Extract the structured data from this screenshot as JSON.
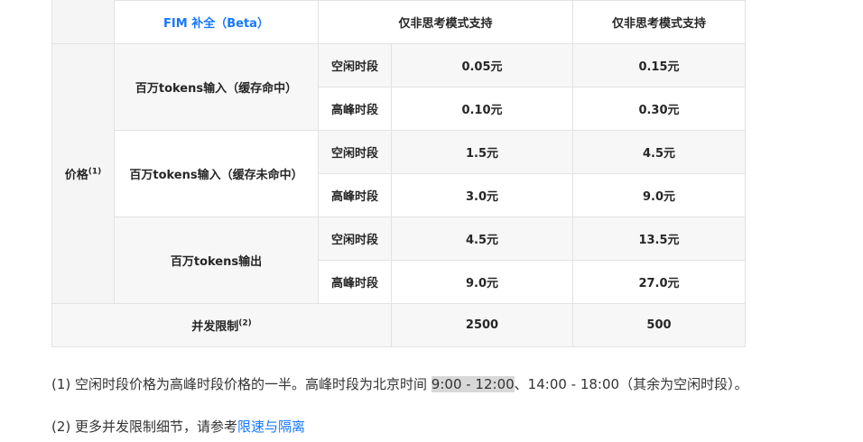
{
  "table": {
    "fim_label": "FIM 补全（Beta）",
    "fim_col1": "仅非思考模式支持",
    "fim_col2": "仅非思考模式支持",
    "price_label": "价格",
    "price_sup": "(1)",
    "groups": [
      {
        "label": "百万tokens输入（缓存命中）",
        "rows": [
          {
            "period": "空闲时段",
            "col1": "0.05元",
            "col2": "0.15元"
          },
          {
            "period": "高峰时段",
            "col1": "0.10元",
            "col2": "0.30元"
          }
        ]
      },
      {
        "label": "百万tokens输入（缓存未命中）",
        "rows": [
          {
            "period": "空闲时段",
            "col1": "1.5元",
            "col2": "4.5元"
          },
          {
            "period": "高峰时段",
            "col1": "3.0元",
            "col2": "9.0元"
          }
        ]
      },
      {
        "label": "百万tokens输出",
        "rows": [
          {
            "period": "空闲时段",
            "col1": "4.5元",
            "col2": "13.5元"
          },
          {
            "period": "高峰时段",
            "col1": "9.0元",
            "col2": "27.0元"
          }
        ]
      }
    ],
    "concurrency_label": "并发限制",
    "concurrency_sup": "(2)",
    "concurrency_col1": "2500",
    "concurrency_col2": "500"
  },
  "notes": {
    "n1_prefix": "(1) 空闲时段价格为高峰时段价格的一半。高峰时段为北京时间 ",
    "n1_highlight": "9:00 - 12:00",
    "n1_suffix": "、14:00 - 18:00（其余为空闲时段）。",
    "n2_prefix": "(2) 更多并发限制细节，请参考",
    "n2_link": "限速与隔离"
  }
}
